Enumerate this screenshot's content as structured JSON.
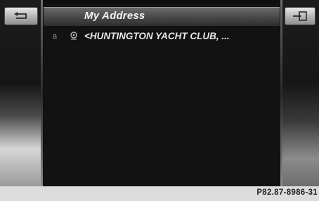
{
  "header": {
    "title": "My Address"
  },
  "buttons": {
    "back_icon": "back-arrow-icon",
    "exit_icon": "exit-icon"
  },
  "list": {
    "items": [
      {
        "marker": "a",
        "icon": "location-icon",
        "label": "<HUNTINGTON YACHT CLUB, ..."
      }
    ]
  },
  "footer": {
    "code": "P82.87-8986-31"
  },
  "colors": {
    "screen_bg": "#121212",
    "text": "#e8e8e8",
    "title_bar": "#4a4a4a"
  }
}
